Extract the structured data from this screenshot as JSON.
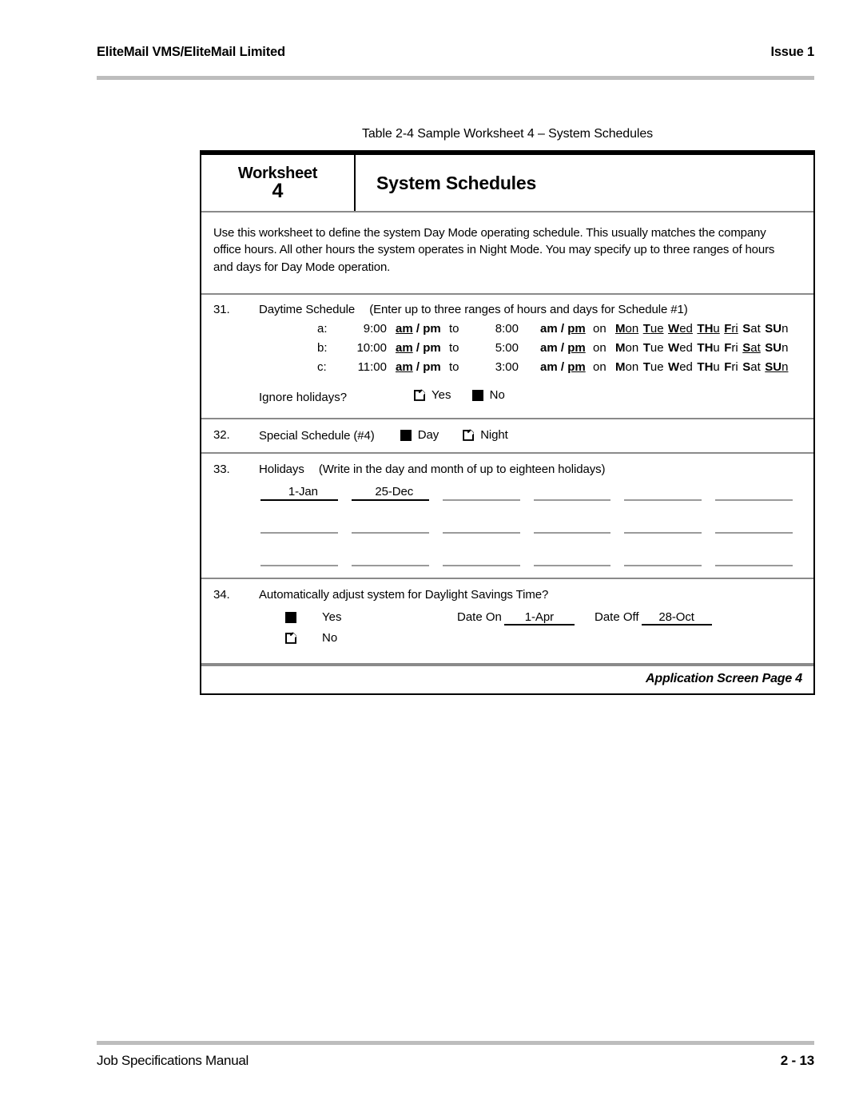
{
  "page_header": {
    "left": "EliteMail VMS/EliteMail Limited",
    "right": "Issue 1"
  },
  "page_footer": {
    "left": "Job Specifications Manual",
    "right": "2 - 13"
  },
  "table_caption": "Table 2-4  Sample Worksheet 4 – System Schedules",
  "worksheet": {
    "label": "Worksheet",
    "number": "4",
    "title": "System Schedules",
    "intro": "Use this worksheet to define the system Day Mode operating schedule. This usually matches the company office hours. All other hours the system operates in Night Mode. You may specify up to three ranges of hours and days for Day Mode operation.",
    "footer_note": "Application Screen Page 4"
  },
  "items": {
    "item31": {
      "number": "31.",
      "title": "Daytime Schedule",
      "hint": "(Enter up to three ranges of hours and days for Schedule #1)",
      "to_label": "to",
      "on_label": "on",
      "am_label": "am",
      "pm_label": "pm",
      "slash": "/",
      "rows": [
        {
          "letter": "a:",
          "start_time": "9:00",
          "start_meridiem_selected": "am",
          "end_time": "8:00",
          "end_meridiem_selected": "pm",
          "days_selected": [
            "Mon",
            "Tue",
            "Wed",
            "THu",
            "Fri"
          ]
        },
        {
          "letter": "b:",
          "start_time": "10:00",
          "start_meridiem_selected": "am",
          "end_time": "5:00",
          "end_meridiem_selected": "pm",
          "days_selected": [
            "Sat"
          ]
        },
        {
          "letter": "c:",
          "start_time": "11:00",
          "start_meridiem_selected": "am",
          "end_time": "3:00",
          "end_meridiem_selected": "pm",
          "days_selected": [
            "SUn"
          ]
        }
      ],
      "days": [
        {
          "cap": "M",
          "rest": "on"
        },
        {
          "cap": "T",
          "rest": "ue"
        },
        {
          "cap": "W",
          "rest": "ed"
        },
        {
          "cap": "TH",
          "rest": "u"
        },
        {
          "cap": "F",
          "rest": "ri"
        },
        {
          "cap": "S",
          "rest": "at"
        },
        {
          "cap": "SU",
          "rest": "n"
        }
      ],
      "ignore_holidays": {
        "label": "Ignore holidays?",
        "yes_label": "Yes",
        "no_label": "No",
        "yes_checked": false,
        "no_checked": true
      }
    },
    "item32": {
      "number": "32.",
      "title": "Special Schedule (#4)",
      "day_label": "Day",
      "night_label": "Night",
      "day_checked": true,
      "night_checked": false
    },
    "item33": {
      "number": "33.",
      "title": "Holidays",
      "hint": "(Write in the day and month of up to eighteen holidays)",
      "entries": [
        "1-Jan",
        "25-Dec",
        "",
        "",
        "",
        "",
        "",
        "",
        "",
        "",
        "",
        "",
        "",
        "",
        "",
        "",
        "",
        ""
      ]
    },
    "item34": {
      "number": "34.",
      "title": "Automatically adjust system for Daylight Savings Time?",
      "yes_label": "Yes",
      "no_label": "No",
      "yes_checked": true,
      "no_checked": false,
      "date_on_label": "Date On",
      "date_on_value": "1-Apr",
      "date_off_label": "Date Off",
      "date_off_value": "28-Oct"
    }
  },
  "colors": {
    "rule_gray": "#bdbdbd",
    "divider_gray": "#8a8a8a",
    "blank_line_gray": "#9a9a9a",
    "ink": "#000000",
    "paper": "#ffffff"
  }
}
